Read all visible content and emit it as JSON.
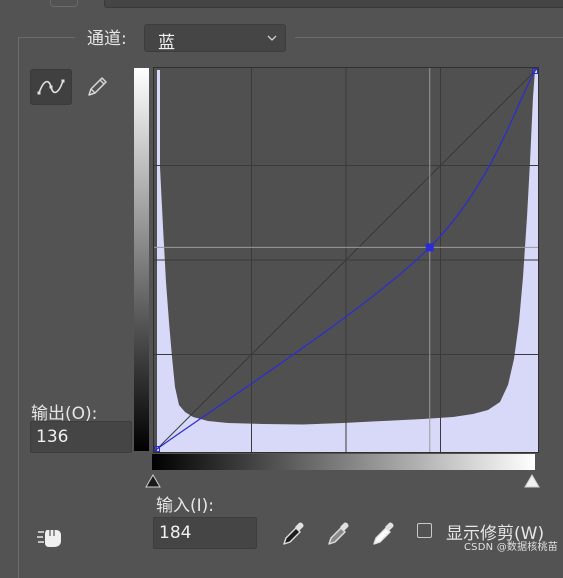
{
  "channel": {
    "label": "通道:",
    "selected": "蓝"
  },
  "tools": {
    "curve_tool_icon": "curve-points-icon",
    "pencil_tool_icon": "pencil-icon",
    "hand_tool_icon": "on-image-adjust-hand-icon"
  },
  "output": {
    "label": "输出(O):",
    "value": "136"
  },
  "input": {
    "label": "输入(I):",
    "value": "184"
  },
  "eyedroppers": [
    "black-point-eyedropper-icon",
    "gray-point-eyedropper-icon",
    "white-point-eyedropper-icon"
  ],
  "show_clipping": {
    "label": "显示修剪(W)",
    "checked": false
  },
  "curve": {
    "channel_color": "#2b2bd6",
    "histogram_fill": "#d8d8f8",
    "points": [
      [
        0,
        0
      ],
      [
        184,
        136
      ],
      [
        255,
        255
      ]
    ],
    "selected_point_index": 1,
    "grid_divisions": 4
  },
  "watermark": "CSDN @数据核桃苗"
}
